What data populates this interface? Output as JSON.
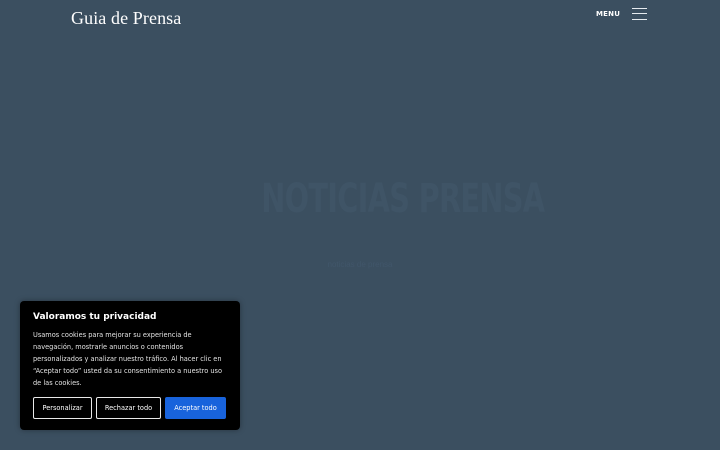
{
  "header": {
    "site_title": "Guia de Prensa",
    "menu_label": "MENU",
    "menu_icon": "hamburger-icon"
  },
  "hero": {
    "title": "NOTICIAS PRENSA",
    "subtitle": "noticias de prensa"
  },
  "cookie_banner": {
    "title": "Valoramos tu privacidad",
    "text": "Usamos cookies para mejorar su experiencia de navegación, mostrarle anuncios o contenidos personalizados y analizar nuestro tráfico. Al hacer clic en “Aceptar todo” usted da su consentimiento a nuestro uso de las cookies.",
    "buttons": {
      "customize": "Personalizar",
      "reject": "Rechazar todo",
      "accept": "Aceptar todo"
    }
  },
  "colors": {
    "background": "#3b4f60",
    "banner_background": "#000000",
    "accent": "#1863dc"
  }
}
